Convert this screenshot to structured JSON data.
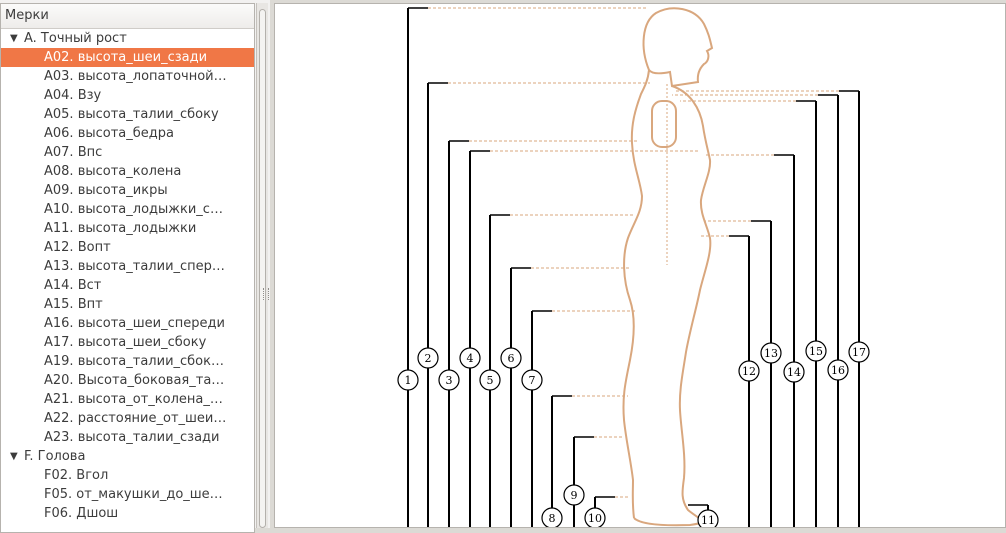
{
  "tree": {
    "header": "Мерки",
    "groups": [
      {
        "label": "A. Точный рост"
      },
      {
        "label": "F. Голова"
      }
    ],
    "items_a": [
      "A02. высота_шеи_сзади",
      "A03. высота_лопаточной…",
      "A04. Взу",
      "A05. высота_талии_сбоку",
      "A06. высота_бедра",
      "A07. Впс",
      "A08. высота_колена",
      "A09. высота_икры",
      "A10. высота_лодыжки_с…",
      "A11. высота_лодыжки",
      "A12. Вопт",
      "A13. высота_талии_спер…",
      "A14. Вст",
      "A15. Впт",
      "A16. высота_шеи_спереди",
      "A17. высота_шеи_сбоку",
      "A19. высота_талии_сбок…",
      "A20. Высота_боковая_та…",
      "A21. высота_от_колена_…",
      "A22. расстояние_от_шеи…",
      "A23. высота_талии_сзади"
    ],
    "items_f": [
      "F02. Вгол",
      "F05. от_макушки_до_ше…",
      "F06. Дшош"
    ],
    "selected_index": 0
  },
  "diagram": {
    "figure_color": "#d9a77e",
    "labels": [
      "1",
      "2",
      "3",
      "4",
      "5",
      "6",
      "7",
      "8",
      "9",
      "10",
      "11",
      "12",
      "13",
      "14",
      "15",
      "16",
      "17"
    ]
  }
}
